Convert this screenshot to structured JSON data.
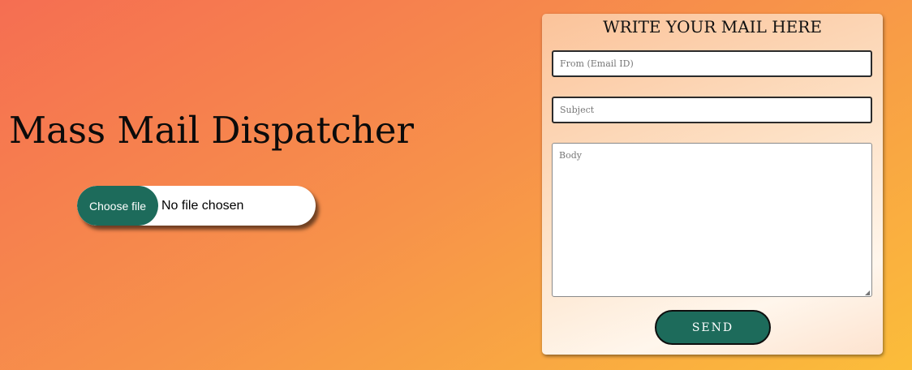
{
  "hero": {
    "title": "Mass Mail Dispatcher"
  },
  "file_input": {
    "button_label": "Choose file",
    "status_text": "No file chosen"
  },
  "mail_form": {
    "title": "WRITE YOUR MAIL HERE",
    "from_placeholder": "From (Email ID)",
    "subject_placeholder": "Subject",
    "body_placeholder": "Body",
    "send_label": "SEND"
  },
  "colors": {
    "accent": "#1d6b5b",
    "background_start": "#f56e52",
    "background_end": "#fbbd3a"
  }
}
